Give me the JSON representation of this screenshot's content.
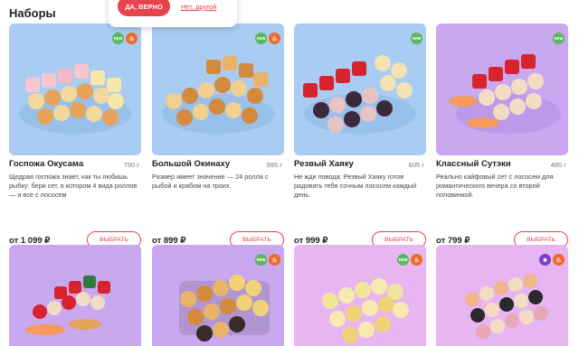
{
  "section": {
    "title": "Наборы"
  },
  "city_popup": {
    "yes_label": "ДА, ВЕРНО",
    "no_label": "Нет, другой"
  },
  "colors": {
    "accent": "#e8424f",
    "blue_bg": "#a9ccf2",
    "purple_bg": "#c8a8ef",
    "pink_bg": "#e7b6f2"
  },
  "badges": {
    "new_label": "new",
    "hot_icon": "fire-icon",
    "star_icon": "star-icon"
  },
  "products": [
    {
      "name": "Госпожа Окусама",
      "weight": "790 г",
      "description": "Щедрая госпожа знает, как ты любишь рыбку: бери сет, в котором 4 вида роллов — и все с лососем",
      "price": "от 1 099 ₽",
      "button": "ВЫБРАТЬ"
    },
    {
      "name": "Большой Окинаху",
      "weight": "595 г",
      "description": "Размер имеет значение — 24 ролла с рыбой и крабом на троих.",
      "price": "от 899 ₽",
      "button": "ВЫБРАТЬ"
    },
    {
      "name": "Резвый Хаяку",
      "weight": "605 г",
      "description": "Не жди повода: Резвый Хаяку готов радовать тебя сочным лососем каждый день.",
      "price": "от 999 ₽",
      "button": "ВЫБРАТЬ"
    },
    {
      "name": "Классный Сутэки",
      "weight": "485 г",
      "description": "Реально кайфовый сет с лососем для романтического вечера со второй половинкой.",
      "price": "от 799 ₽",
      "button": "ВЫБРАТЬ"
    }
  ]
}
